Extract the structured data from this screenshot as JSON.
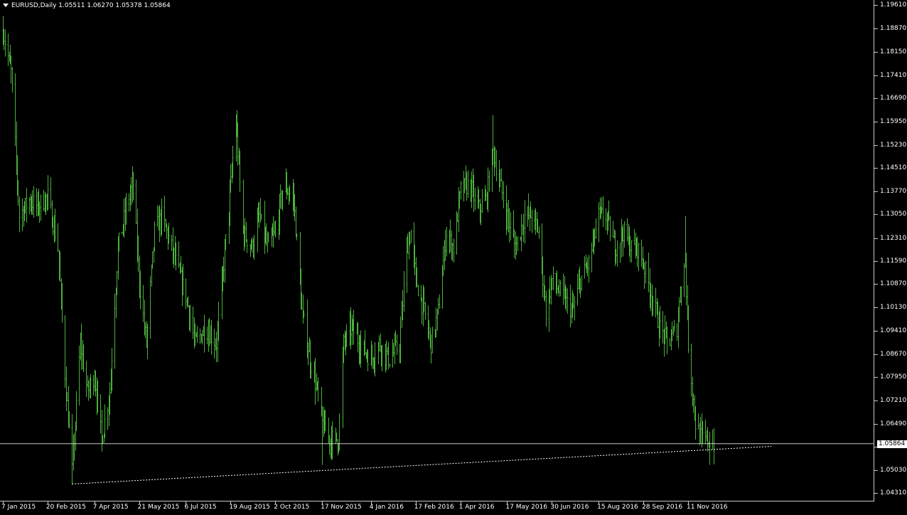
{
  "window": {
    "symbol": "EURUSD",
    "timeframe": "Daily",
    "header_text": "EURUSD,Daily  1.05511 1.06270 1.05378 1.05864"
  },
  "colors": {
    "background": "#000000",
    "bars": "#4caf3c",
    "axis": "#c8c8c8",
    "text": "#ffffff",
    "trendline": "#ffffff"
  },
  "chart_data": {
    "type": "ohlc-bar",
    "symbol": "EURUSD",
    "timeframe": "Daily",
    "ohlc_last": {
      "open": 1.05511,
      "high": 1.0627,
      "low": 1.05378,
      "close": 1.05864
    },
    "current_price": "1.05864",
    "y_ticks": [
      "1.19610",
      "1.18870",
      "1.18150",
      "1.17410",
      "1.16690",
      "1.15950",
      "1.15230",
      "1.14510",
      "1.13770",
      "1.13050",
      "1.12310",
      "1.11590",
      "1.10870",
      "1.10130",
      "1.09410",
      "1.08670",
      "1.07950",
      "1.07210",
      "1.06490",
      "1.05770",
      "1.05030",
      "1.04310"
    ],
    "x_ticks": [
      "7 Jan 2015",
      "20 Feb 2015",
      "7 Apr 2015",
      "21 May 2015",
      "6 Jul 2015",
      "19 Aug 2015",
      "2 Oct 2015",
      "17 Nov 2015",
      "4 Jan 2016",
      "17 Feb 2016",
      "1 Apr 2016",
      "17 May 2016",
      "30 Jun 2016",
      "15 Aug 2016",
      "28 Sep 2016",
      "11 Nov 2016"
    ],
    "ylim": [
      1.0431,
      1.1961
    ],
    "price_path": [
      [
        "7 Jan 2015",
        1.188
      ],
      [
        "15 Jan 2015",
        1.175
      ],
      [
        "23 Jan 2015",
        1.13
      ],
      [
        "2 Feb 2015",
        1.135
      ],
      [
        "10 Feb 2015",
        1.133
      ],
      [
        "20 Feb 2015",
        1.136
      ],
      [
        "2 Mar 2015",
        1.12
      ],
      [
        "10 Mar 2015",
        1.075
      ],
      [
        "16 Mar 2015",
        1.05
      ],
      [
        "24 Mar 2015",
        1.09
      ],
      [
        "31 Mar 2015",
        1.075
      ],
      [
        "7 Apr 2015",
        1.08
      ],
      [
        "14 Apr 2015",
        1.06
      ],
      [
        "22 Apr 2015",
        1.075
      ],
      [
        "30 Apr 2015",
        1.12
      ],
      [
        "10 May 2015",
        1.135
      ],
      [
        "15 May 2015",
        1.14
      ],
      [
        "21 May 2015",
        1.11
      ],
      [
        "28 May 2015",
        1.09
      ],
      [
        "5 Jun 2015",
        1.125
      ],
      [
        "12 Jun 2015",
        1.13
      ],
      [
        "22 Jun 2015",
        1.12
      ],
      [
        "1 Jul 2015",
        1.11
      ],
      [
        "6 Jul 2015",
        1.105
      ],
      [
        "15 Jul 2015",
        1.09
      ],
      [
        "25 Jul 2015",
        1.095
      ],
      [
        "5 Aug 2015",
        1.09
      ],
      [
        "12 Aug 2015",
        1.115
      ],
      [
        "19 Aug 2015",
        1.14
      ],
      [
        "24 Aug 2015",
        1.16
      ],
      [
        "31 Aug 2015",
        1.125
      ],
      [
        "9 Sep 2015",
        1.12
      ],
      [
        "16 Sep 2015",
        1.13
      ],
      [
        "24 Sep 2015",
        1.12
      ],
      [
        "2 Oct 2015",
        1.125
      ],
      [
        "10 Oct 2015",
        1.14
      ],
      [
        "20 Oct 2015",
        1.135
      ],
      [
        "28 Oct 2015",
        1.1
      ],
      [
        "5 Nov 2015",
        1.085
      ],
      [
        "12 Nov 2015",
        1.075
      ],
      [
        "17 Nov 2015",
        1.065
      ],
      [
        "24 Nov 2015",
        1.06
      ],
      [
        "3 Dec 2015",
        1.06
      ],
      [
        "8 Dec 2015",
        1.09
      ],
      [
        "16 Dec 2015",
        1.095
      ],
      [
        "24 Dec 2015",
        1.09
      ],
      [
        "4 Jan 2016",
        1.085
      ],
      [
        "12 Jan 2016",
        1.09
      ],
      [
        "22 Jan 2016",
        1.085
      ],
      [
        "1 Feb 2016",
        1.09
      ],
      [
        "8 Feb 2016",
        1.12
      ],
      [
        "12 Feb 2016",
        1.125
      ],
      [
        "17 Feb 2016",
        1.11
      ],
      [
        "25 Feb 2016",
        1.1
      ],
      [
        "3 Mar 2016",
        1.09
      ],
      [
        "10 Mar 2016",
        1.1
      ],
      [
        "18 Mar 2016",
        1.125
      ],
      [
        "25 Mar 2016",
        1.12
      ],
      [
        "1 Apr 2016",
        1.138
      ],
      [
        "10 Apr 2016",
        1.14
      ],
      [
        "18 Apr 2016",
        1.132
      ],
      [
        "26 Apr 2016",
        1.135
      ],
      [
        "3 May 2016",
        1.15
      ],
      [
        "10 May 2016",
        1.14
      ],
      [
        "17 May 2016",
        1.13
      ],
      [
        "25 May 2016",
        1.12
      ],
      [
        "3 Jun 2016",
        1.13
      ],
      [
        "10 Jun 2016",
        1.13
      ],
      [
        "17 Jun 2016",
        1.125
      ],
      [
        "24 Jun 2016",
        1.1
      ],
      [
        "30 Jun 2016",
        1.11
      ],
      [
        "10 Jul 2016",
        1.105
      ],
      [
        "20 Jul 2016",
        1.1
      ],
      [
        "28 Jul 2016",
        1.11
      ],
      [
        "5 Aug 2016",
        1.115
      ],
      [
        "15 Aug 2016",
        1.13
      ],
      [
        "22 Aug 2016",
        1.13
      ],
      [
        "31 Aug 2016",
        1.12
      ],
      [
        "8 Sep 2016",
        1.125
      ],
      [
        "16 Sep 2016",
        1.12
      ],
      [
        "22 Sep 2016",
        1.12
      ],
      [
        "28 Sep 2016",
        1.115
      ],
      [
        "6 Oct 2016",
        1.105
      ],
      [
        "14 Oct 2016",
        1.095
      ],
      [
        "22 Oct 2016",
        1.09
      ],
      [
        "31 Oct 2016",
        1.095
      ],
      [
        "4 Nov 2016",
        1.11
      ],
      [
        "8 Nov 2016",
        1.115
      ],
      [
        "11 Nov 2016",
        1.09
      ],
      [
        "18 Nov 2016",
        1.065
      ],
      [
        "24 Nov 2016",
        1.06
      ],
      [
        "1 Dec 2016",
        1.06
      ],
      [
        "6 Dec 2016",
        1.0586
      ]
    ],
    "spikes": [
      [
        "22 Aug 2015",
        1.1714
      ],
      [
        "16 Mar 2015",
        1.0458
      ],
      [
        "17 Nov 2015",
        1.052
      ],
      [
        "3 May 2016",
        1.1616
      ],
      [
        "8 Nov 2016",
        1.13
      ],
      [
        "2 Dec 2016",
        1.052
      ]
    ],
    "trendline": {
      "style": "dotted",
      "points": [
        [
          "16 Mar 2015",
          1.046
        ],
        [
          "1 Feb 2017",
          1.0578
        ]
      ]
    },
    "grid": false,
    "legend": "none"
  }
}
